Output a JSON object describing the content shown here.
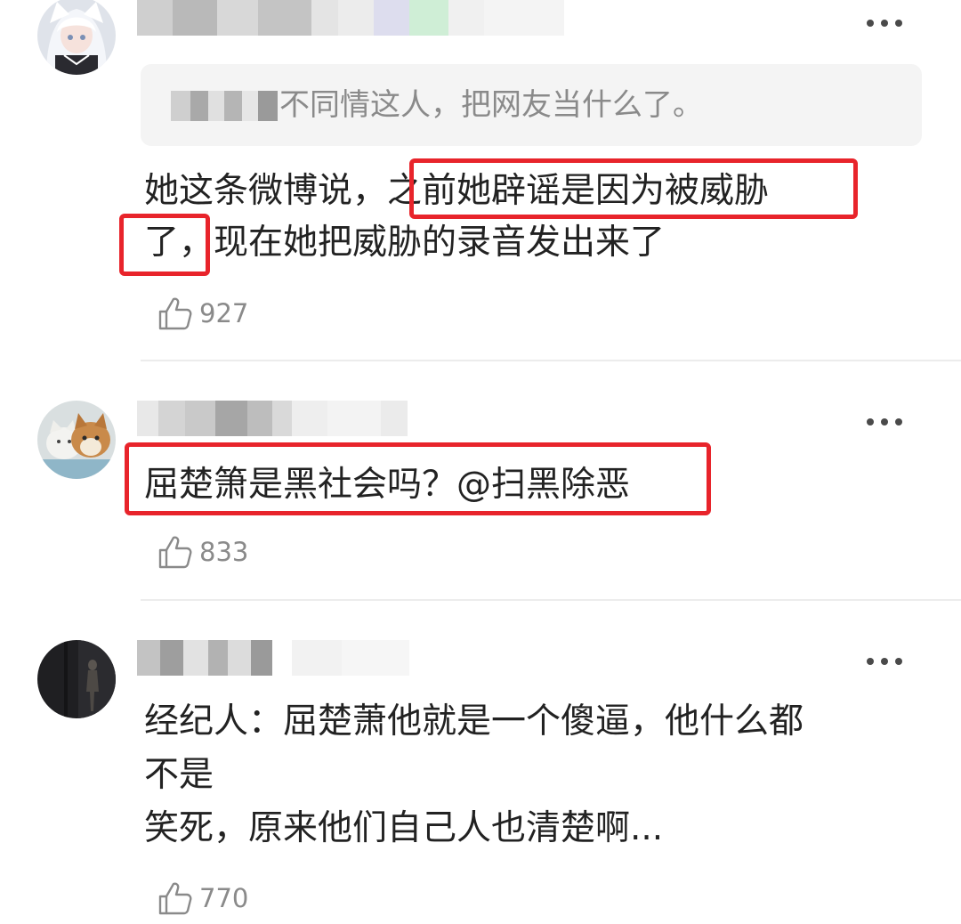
{
  "comments": [
    {
      "quote": {
        "text": "不同情这人，把网友当什么了。"
      },
      "body_lines": [
        "她这条微博说，之前她辟谣是因为被威胁",
        "了，现在她把威胁的录音发出来了"
      ],
      "likes": "927",
      "highlighted": true
    },
    {
      "body_lines": [
        "屈楚箫是黑社会吗？@扫黑除恶"
      ],
      "likes": "833",
      "highlighted": true
    },
    {
      "body_lines": [
        "经纪人：屈楚萧他就是一个傻逼，他什么都",
        "不是",
        "笑死，原来他们自己人也清楚啊..."
      ],
      "likes": "770",
      "highlighted": false
    }
  ],
  "icons": {
    "like": "thumbs-up-icon",
    "more": "more-dots-icon"
  },
  "colors": {
    "highlight_border": "#e8242b",
    "quote_background": "#f4f4f4",
    "body_text": "#222222",
    "secondary_text": "#8a8a8a"
  }
}
